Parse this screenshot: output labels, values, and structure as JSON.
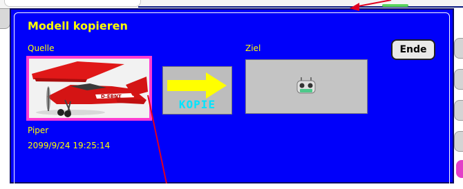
{
  "dialog": {
    "title": "Modell kopieren",
    "source_label": "Quelle",
    "dest_label": "Ziel",
    "end_button": "Ende",
    "copy_label": "KOPIE",
    "model_name": "Piper",
    "model_datetime": "2099/9/24  19:25:14",
    "plane_registration": "D-EBNT"
  },
  "colors": {
    "dialog_bg": "#0000fa",
    "text_yellow": "#ffff00",
    "source_frame": "#ff3cd2",
    "arrow_yellow": "#ffff00",
    "copy_text": "#00e5ff",
    "annotation_red": "#e00020"
  },
  "icons": {
    "copy_arrow": "right-arrow-icon",
    "transmitter": "transmitter-icon",
    "plane": "airplane-image"
  }
}
